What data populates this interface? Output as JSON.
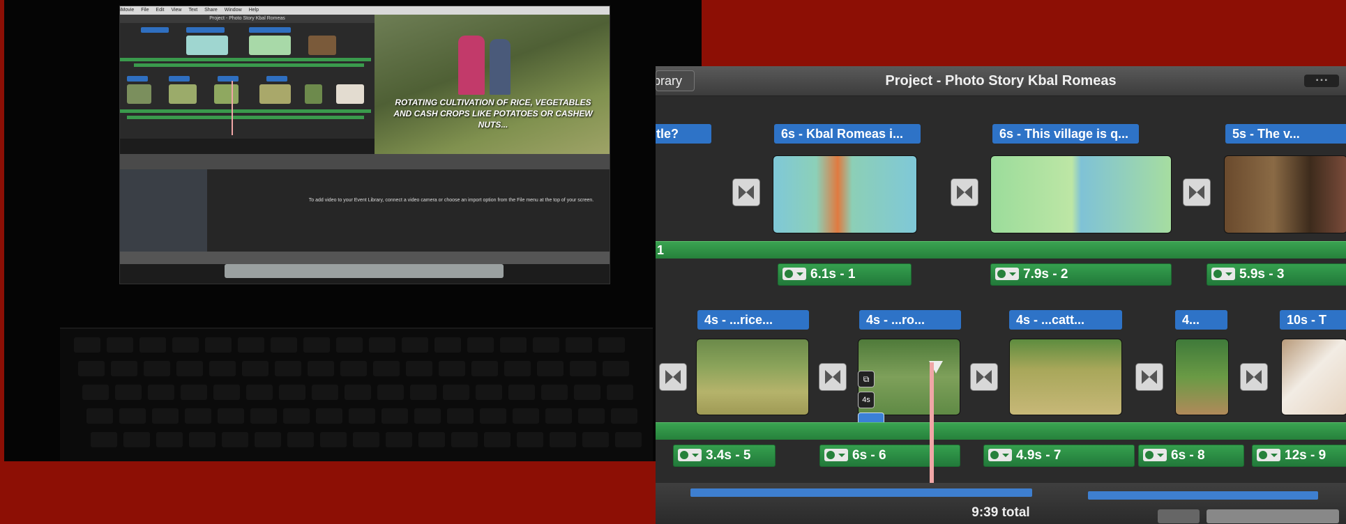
{
  "laptop": {
    "menubar": [
      "iMovie",
      "File",
      "Edit",
      "View",
      "Text",
      "Share",
      "Window",
      "Help"
    ],
    "mini_title": "Project - Photo Story Kbal Romeas",
    "photo_caption": "ROTATING CULTIVATION OF RICE, VEGETABLES AND CASH CROPS LIKE POTATOES OR CASHEW NUTS...",
    "library_text": "To add video to your Event Library, connect a video camera or choose an import option from the File menu at the top of your screen."
  },
  "zoom": {
    "library_tab": "Library",
    "project_title": "Project - Photo Story Kbal Romeas",
    "window_buttons": "▪ ▪ ▪",
    "row1": {
      "labels": [
        "title?",
        "6s - Kbal Romeas i...",
        "6s - This village is q...",
        "5s - The  v..."
      ],
      "audio": [
        "1",
        "6.1s - 1",
        "7.9s - 2",
        "5.9s - 3"
      ]
    },
    "row2": {
      "labels": [
        "4s - ...rice...",
        "4s - ...ro...",
        "4s - ...catt...",
        "4...",
        "10s - T"
      ],
      "audio": [
        "3.4s - 5",
        "6s - 6",
        "4.9s - 7",
        "6s - 8",
        "12s - 9"
      ],
      "overlay_duration": "4s"
    },
    "total": "9:39 total"
  },
  "colors": {
    "background": "#8d0f05",
    "clip_label": "#2e73c7",
    "audio_green": "#2f9447",
    "playhead": "#f0a6a6"
  }
}
